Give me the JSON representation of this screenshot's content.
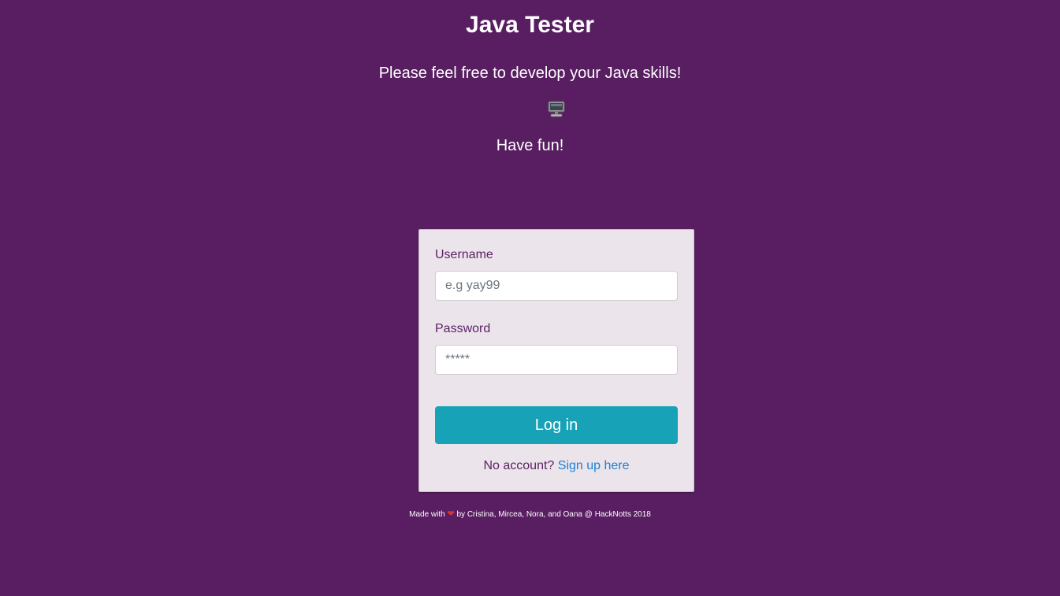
{
  "header": {
    "title": "Java Tester",
    "subtitle": "Please feel free to develop your Java skills!",
    "icon": "computer-icon",
    "tagline": "Have fun!"
  },
  "login_form": {
    "username_label": "Username",
    "username_placeholder": "e.g yay99",
    "username_value": "",
    "password_label": "Password",
    "password_placeholder": "*****",
    "password_value": "",
    "submit_label": "Log in",
    "signup_prompt": "No account?",
    "signup_link": "Sign up here"
  },
  "footer": {
    "made_with": "Made with",
    "heart_icon": "heart-icon",
    "heart_glyph": "❤",
    "credits": "by Cristina, Mircea, Nora, and Oana @ HackNotts 2018"
  },
  "colors": {
    "background": "#581e61",
    "card": "#ebe4eb",
    "button": "#17a2b8",
    "link": "#1c7fd6",
    "heart": "#d9342b"
  }
}
